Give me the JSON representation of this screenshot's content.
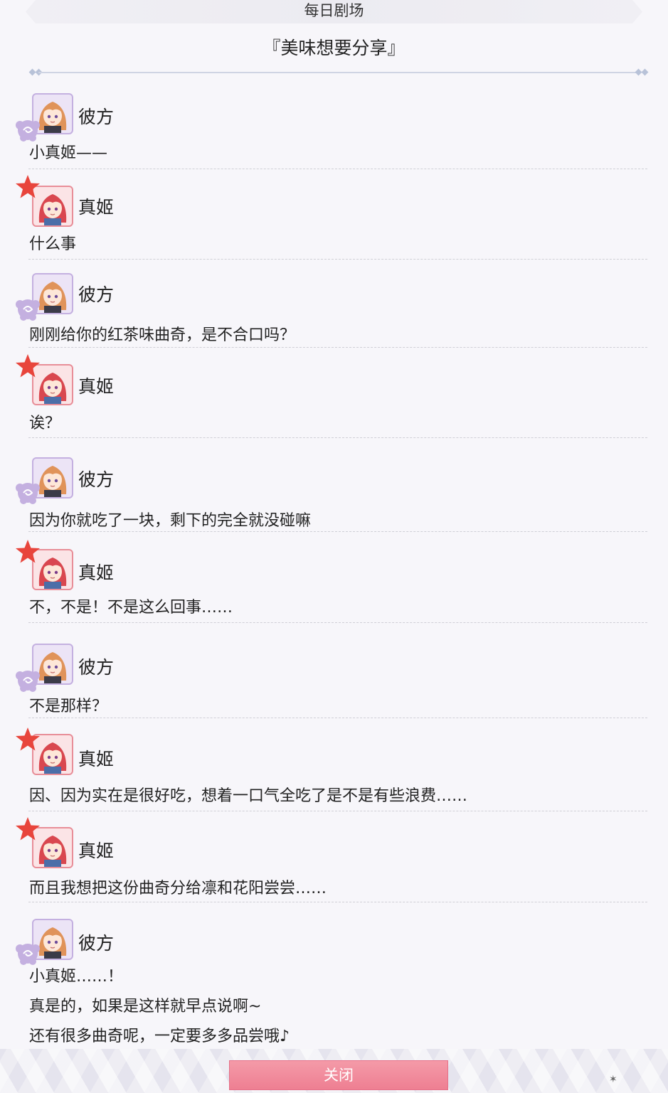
{
  "header": {
    "title": "每日剧场",
    "story_title": "『美味想要分享』"
  },
  "dialogue": [
    {
      "speaker": "彼方",
      "lines": [
        "小真姬——"
      ]
    },
    {
      "speaker": "真姬",
      "lines": [
        "什么事"
      ]
    },
    {
      "speaker": "彼方",
      "lines": [
        "刚刚给你的红茶味曲奇，是不合口吗？"
      ]
    },
    {
      "speaker": "真姬",
      "lines": [
        "诶？"
      ]
    },
    {
      "speaker": "彼方",
      "lines": [
        "因为你就吃了一块，剩下的完全就没碰嘛"
      ]
    },
    {
      "speaker": "真姬",
      "lines": [
        "不，不是！不是这么回事……"
      ]
    },
    {
      "speaker": "彼方",
      "lines": [
        "不是那样？"
      ]
    },
    {
      "speaker": "真姬",
      "lines": [
        "因、因为实在是很好吃，想着一口气全吃了是不是有些浪费……"
      ]
    },
    {
      "speaker": "真姬",
      "lines": [
        "而且我想把这份曲奇分给凛和花阳尝尝……"
      ]
    },
    {
      "speaker": "彼方",
      "lines": [
        "小真姬……！",
        "真是的，如果是这样就早点说啊~",
        "还有很多曲奇呢，一定要多多品尝哦♪"
      ]
    }
  ],
  "icons": {
    "kanata_badge": "sheep-icon",
    "maki_badge": "star-icon",
    "kanata_color": "#c4b0e0",
    "maki_color": "#e8453c"
  },
  "footer": {
    "close_label": "关闭"
  }
}
